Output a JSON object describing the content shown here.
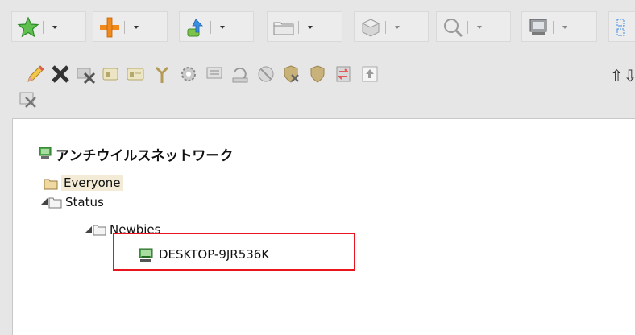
{
  "toolbar": {
    "dropdowns": [
      {
        "icon": "star-icon"
      },
      {
        "icon": "plus-icon"
      },
      {
        "icon": "deploy-icon"
      },
      {
        "icon": "folder-icon"
      },
      {
        "icon": "package-icon"
      },
      {
        "icon": "search-icon"
      },
      {
        "icon": "computer-icon"
      },
      {
        "icon": "layout-icon"
      }
    ],
    "actions": [
      {
        "icon": "pencil-icon"
      },
      {
        "icon": "delete-icon"
      },
      {
        "icon": "remove-icon"
      },
      {
        "icon": "card-icon"
      },
      {
        "icon": "card-alt-icon"
      },
      {
        "icon": "tree-icon"
      },
      {
        "icon": "gear-icon"
      },
      {
        "icon": "comment-icon"
      },
      {
        "icon": "restore-icon"
      },
      {
        "icon": "block-icon"
      },
      {
        "icon": "shield-remove-icon"
      },
      {
        "icon": "shield-icon"
      },
      {
        "icon": "swap-icon"
      },
      {
        "icon": "upload-icon"
      }
    ],
    "extra_action": {
      "icon": "export-icon"
    },
    "overflow_text": "⇧⇩"
  },
  "tree": {
    "root": {
      "label": "アンチウイルスネットワーク",
      "icon": "network-icon"
    },
    "nodes": [
      {
        "label": "Everyone",
        "icon": "folder-icon"
      },
      {
        "label": "Status",
        "icon": "folder-icon"
      },
      {
        "label": "Newbies",
        "icon": "folder-icon"
      },
      {
        "label": "DESKTOP-9JR536K",
        "icon": "computer-icon"
      }
    ]
  },
  "colors": {
    "highlight_border": "#e8141e",
    "everyone_bg": "#f3ebd5",
    "accent_green": "#41a64b",
    "accent_orange": "#f08a1c"
  }
}
